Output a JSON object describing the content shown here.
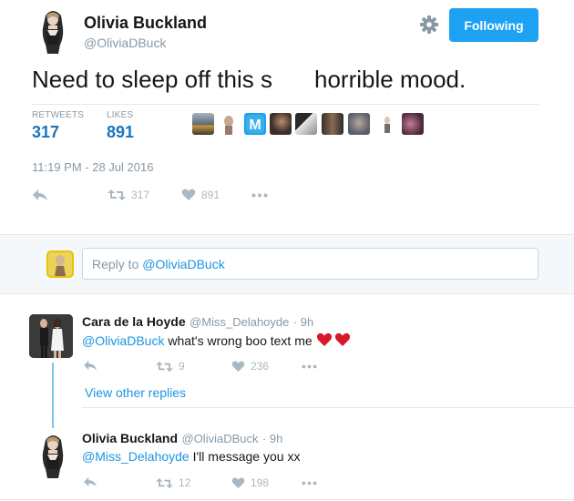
{
  "tweet": {
    "author_name": "Olivia Buckland",
    "author_handle": "@OliviaDBuck",
    "follow_label": "Following",
    "text_before": "Need to sleep off this s",
    "text_after": "horrible mood.",
    "retweets_label": "RETWEETS",
    "retweets_count": "317",
    "likes_label": "LIKES",
    "likes_count": "891",
    "timestamp": "11:19 PM - 28 Jul 2016",
    "actions": {
      "retweets": "317",
      "likes": "891"
    }
  },
  "likers": [
    {
      "name": "liker-1",
      "color": "#6b7b8c"
    },
    {
      "name": "liker-2",
      "color": "#c9a68f"
    },
    {
      "name": "liker-3",
      "color": "#1da1f2"
    },
    {
      "name": "liker-4",
      "color": "#3a2f2a"
    },
    {
      "name": "liker-5",
      "color": "#5a5a5a"
    },
    {
      "name": "liker-6",
      "color": "#7a5a48"
    },
    {
      "name": "liker-7",
      "color": "#8a8fa0"
    },
    {
      "name": "liker-8",
      "color": "#e8d8d0"
    },
    {
      "name": "liker-9",
      "color": "#6b3a55"
    }
  ],
  "reply_box": {
    "prefix": "Reply to ",
    "mention": "@OliviaDBuck"
  },
  "replies": [
    {
      "name": "Cara de la Hoyde",
      "handle": "@Miss_Delahoyde",
      "time": "· 9h",
      "mention": "@OliviaDBuck",
      "text": " what's wrong boo text me",
      "retweets": "9",
      "likes": "236"
    },
    {
      "name": "Olivia Buckland",
      "handle": "@OliviaDBuck",
      "time": "· 9h",
      "mention": "@Miss_Delahoyde",
      "text": " I'll message you xx",
      "retweets": "12",
      "likes": "198"
    }
  ],
  "view_other_replies": "View other replies",
  "colors": {
    "accent": "#1da1f2",
    "link": "#1b95e0",
    "muted": "#8899a6",
    "heart": "#e0245e"
  }
}
